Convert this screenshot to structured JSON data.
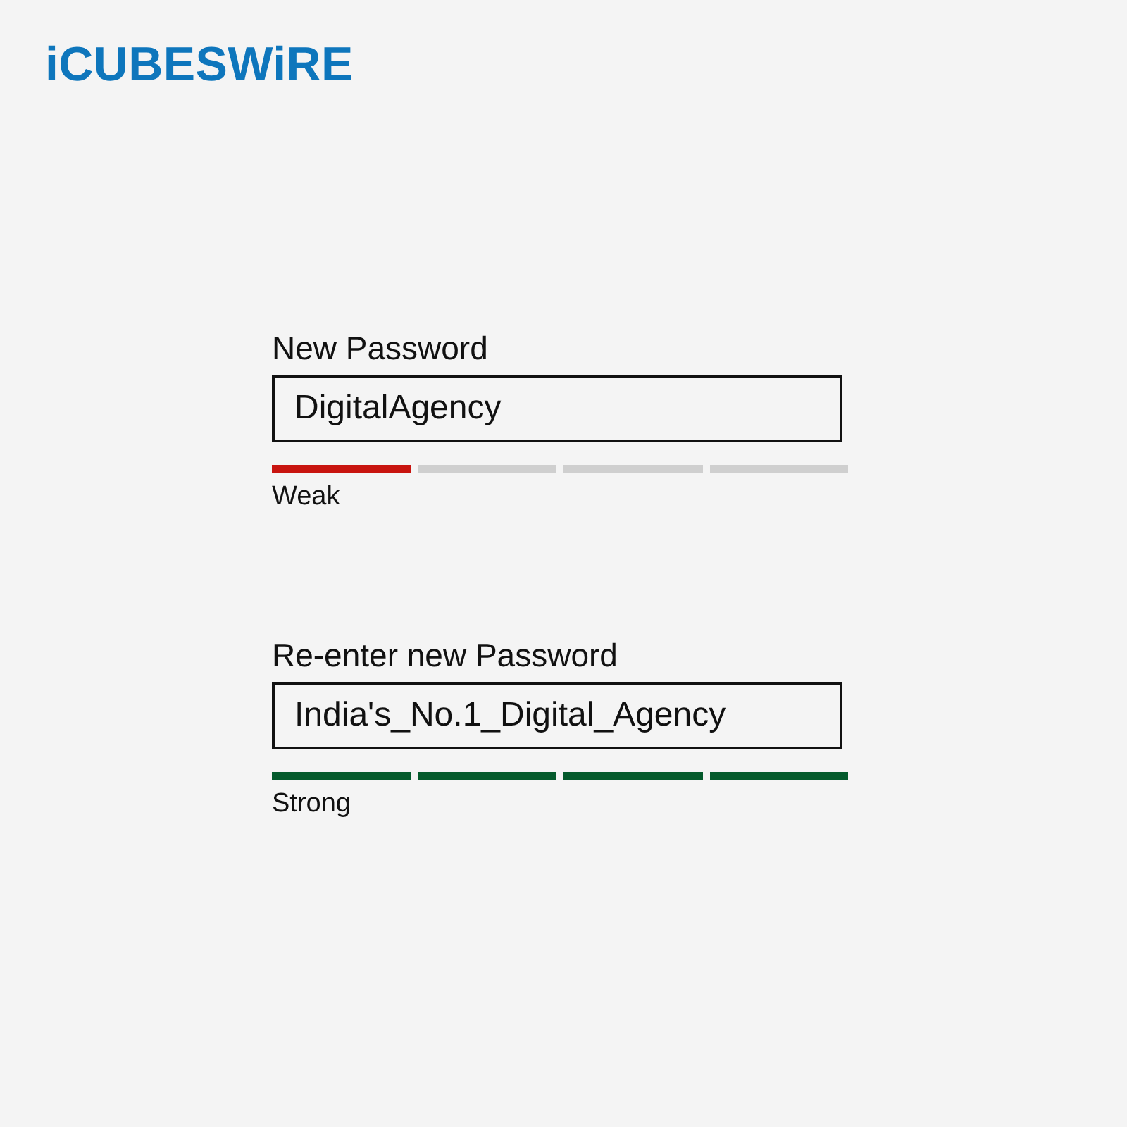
{
  "logo": {
    "text": "iCUBESWiRE"
  },
  "fields": [
    {
      "label": "New Password",
      "value": "DigitalAgency",
      "meter": {
        "color": "#c8140f",
        "segments": [
          {
            "on": true
          },
          {
            "on": false
          },
          {
            "on": false
          },
          {
            "on": false
          }
        ]
      },
      "strength": "Weak"
    },
    {
      "label": "Re-enter new Password",
      "value": "India's_No.1_Digital_Agency",
      "meter": {
        "color": "#045a2c",
        "segments": [
          {
            "on": true
          },
          {
            "on": true
          },
          {
            "on": true
          },
          {
            "on": true
          }
        ]
      },
      "strength": "Strong"
    }
  ]
}
